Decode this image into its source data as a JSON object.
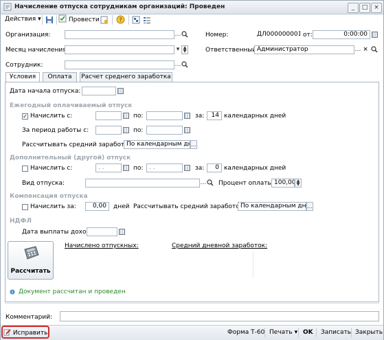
{
  "window": {
    "title": "Начисление отпуска сотрудникам организаций: Проведен",
    "controls": [
      "_",
      "□",
      "×"
    ]
  },
  "toolbar": {
    "actions_label": "Действия",
    "post_label": "Провести"
  },
  "header": {
    "org_label": "Организация:",
    "org_value": "",
    "month_label": "Месяц начисления:",
    "month_value": "",
    "employee_label": "Сотрудник:",
    "employee_value": "",
    "number_label": "Номер:",
    "number_value": "ДЛ000000001",
    "from_label": "от:",
    "date_value": "0:00:00",
    "responsible_label": "Ответственный:",
    "responsible_value": "Администратор"
  },
  "tabs": [
    {
      "label": "Условия",
      "active": true
    },
    {
      "label": "Оплата",
      "active": false
    },
    {
      "label": "Расчет среднего заработка",
      "active": false
    }
  ],
  "conditions": {
    "vacation_start_label": "Дата начала отпуска:",
    "vacation_start_value": "",
    "annual": {
      "heading": "Ежегодный оплачиваемый отпуск",
      "accrue_label": "Начислить с:",
      "accrue_checked": true,
      "from_value": "",
      "to_label": "по:",
      "to_value": "",
      "for_label": "за:",
      "days_value": "14",
      "days_label": "календарных дней",
      "period_label": "За период работы с:",
      "period_from": "",
      "period_to_label": "по:",
      "period_to": "",
      "avg_label": "Рассчитывать средний заработок:",
      "avg_value": "По календарным дня"
    },
    "additional": {
      "heading": "Дополнительный (другой) отпуск",
      "accrue_label": "Начислить с:",
      "accrue_checked": false,
      "from_value": ". .",
      "to_label": "по:",
      "to_value": ". .",
      "for_label": "за:",
      "days_value": "0",
      "days_label": "календарных дней",
      "type_label": "Вид отпуска:",
      "type_value": "",
      "percent_label": "Процент оплаты:",
      "percent_value": "100,00"
    },
    "compensation": {
      "heading": "Компенсация отпуска",
      "accrue_label": "Начислить за:",
      "accrue_checked": false,
      "days_value": "0,00",
      "days_label": "дней",
      "avg_label": "Рассчитывать средний заработок:",
      "avg_value": "По календарным дням"
    },
    "ndfl": {
      "heading": "НДФЛ",
      "pay_date_label": "Дата выплаты дохода:",
      "pay_date_value": ""
    },
    "calc_button_label": "Рассчитать",
    "accrued_label": "Начислено отпускных:",
    "avg_daily_label": "Средний дневной заработок:"
  },
  "status_text": "Документ рассчитан и проведен",
  "comment_label": "Комментарий:",
  "comment_value": "",
  "bottom": {
    "fix_label": "Исправить",
    "form_label": "Форма Т-60",
    "print_label": "Печать",
    "ok_label": "OK",
    "save_label": "Записать",
    "close_label": "Закрыть"
  },
  "colors": {
    "status_green": "#2a8a2a",
    "highlight_red": "#cc2b2b",
    "heading_gray": "#a0a8b0"
  }
}
